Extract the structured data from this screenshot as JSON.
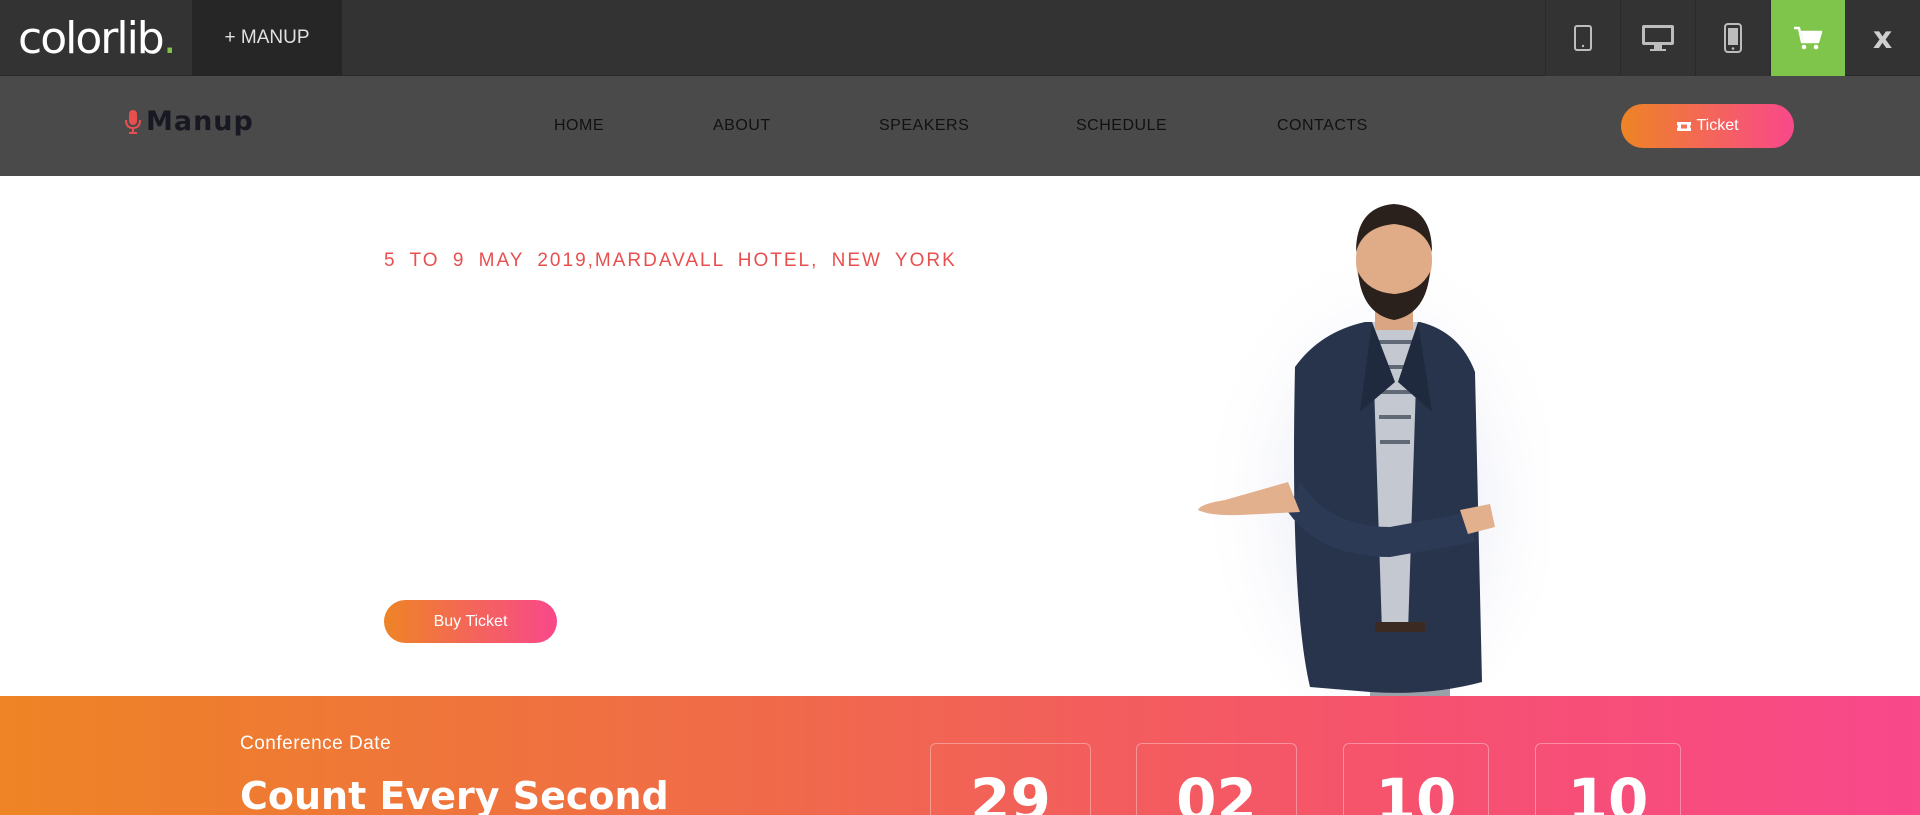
{
  "topbar": {
    "logo_text": "colorlib",
    "logo_dot": ".",
    "product_button": "+ MANUP",
    "devices": [
      "tablet-icon",
      "desktop-icon",
      "mobile-icon"
    ],
    "cart_icon": "cart-icon",
    "close_label": "x",
    "accent_color": "#80c54b"
  },
  "header": {
    "brand": "Manup",
    "brand_icon": "microphone-icon",
    "nav": [
      "HOME",
      "ABOUT",
      "SPEAKERS",
      "SCHEDULE",
      "CONTACTS"
    ],
    "ticket_icon": "ticket-icon",
    "ticket_label": "Ticket"
  },
  "hero": {
    "date_line": "5 TO 9 MAY 2019,MARDAVALL HOTEL, NEW YORK",
    "buy_button": "Buy Ticket",
    "accent_color": "#e94f4f"
  },
  "countdown": {
    "label": "Conference Date",
    "title": "Count Every Second",
    "values": [
      "29",
      "02",
      "10",
      "10"
    ],
    "gradient": [
      "#ee8425",
      "#f9488b"
    ]
  }
}
